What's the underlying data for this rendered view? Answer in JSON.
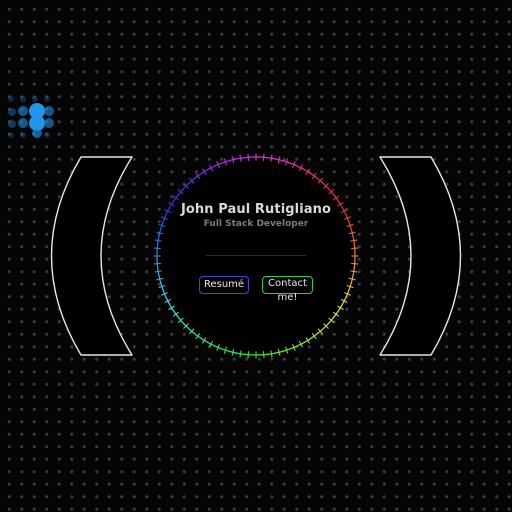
{
  "profile": {
    "name": "John Paul Rutigliano",
    "role": "Full Stack Developer"
  },
  "buttons": {
    "resume_label": "Resumé",
    "contact_label": "Contact me!"
  },
  "colors": {
    "background": "#050505",
    "grid_dot": "#3a3a3a",
    "menu_dot": "#1f86d6",
    "resume_border": "#4646c8",
    "contact_border": "#3ec84a",
    "bracket_stroke": "#e6e6e6"
  },
  "icons": {
    "menu": "dot-grid-menu-icon"
  }
}
